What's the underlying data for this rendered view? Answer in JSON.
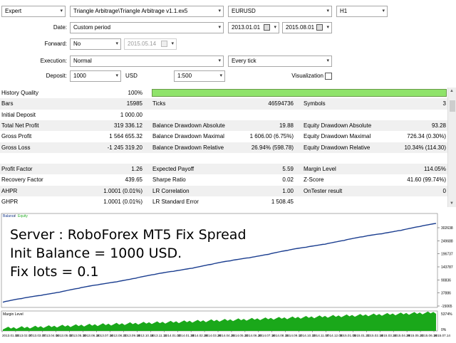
{
  "settings": {
    "mode": "Expert",
    "expert_file": "Triangle Arbitrage\\Triangle Arbitrage v1.1.ex5",
    "symbol": "EURUSD",
    "timeframe": "H1",
    "date_label": "Date:",
    "date_mode": "Custom period",
    "date_from": "2013.01.01",
    "date_to": "2015.08.01",
    "forward_label": "Forward:",
    "forward_value": "No",
    "forward_date": "2015.05.14",
    "execution_label": "Execution:",
    "execution_value": "Normal",
    "tick_model": "Every tick",
    "deposit_label": "Deposit:",
    "deposit_value": "1000",
    "currency": "USD",
    "leverage": "1:500",
    "visualization_label": "Visualization"
  },
  "stats": {
    "history_quality_label": "History Quality",
    "history_quality_value": "100%",
    "rows": [
      {
        "c1l": "Bars",
        "c1v": "15985",
        "c2l": "Ticks",
        "c2v": "46594736",
        "c3l": "Symbols",
        "c3v": "3"
      },
      {
        "c1l": "Initial Deposit",
        "c1v": "1 000.00",
        "c2l": "",
        "c2v": "",
        "c3l": "",
        "c3v": ""
      },
      {
        "c1l": "Total Net Profit",
        "c1v": "319 336.12",
        "c2l": "Balance Drawdown Absolute",
        "c2v": "19.88",
        "c3l": "Equity Drawdown Absolute",
        "c3v": "93.28"
      },
      {
        "c1l": "Gross Profit",
        "c1v": "1 564 655.32",
        "c2l": "Balance Drawdown Maximal",
        "c2v": "1 606.00 (6.75%)",
        "c3l": "Equity Drawdown Maximal",
        "c3v": "726.34 (0.30%)"
      },
      {
        "c1l": "Gross Loss",
        "c1v": "-1 245 319.20",
        "c2l": "Balance Drawdown Relative",
        "c2v": "26.94% (598.78)",
        "c3l": "Equity Drawdown Relative",
        "c3v": "10.34% (114.30)"
      },
      {
        "c1l": "",
        "c1v": "",
        "c2l": "",
        "c2v": "",
        "c3l": "",
        "c3v": ""
      },
      {
        "c1l": "Profit Factor",
        "c1v": "1.26",
        "c2l": "Expected Payoff",
        "c2v": "5.59",
        "c3l": "Margin Level",
        "c3v": "114.05%"
      },
      {
        "c1l": "Recovery Factor",
        "c1v": "439.65",
        "c2l": "Sharpe Ratio",
        "c2v": "0.02",
        "c3l": "Z-Score",
        "c3v": "41.60 (99.74%)"
      },
      {
        "c1l": "AHPR",
        "c1v": "1.0001 (0.01%)",
        "c2l": "LR Correlation",
        "c2v": "1.00",
        "c3l": "OnTester result",
        "c3v": "0"
      },
      {
        "c1l": "GHPR",
        "c1v": "1.0001 (0.01%)",
        "c2l": "LR Standard Error",
        "c2v": "1 508.45",
        "c3l": "",
        "c3v": ""
      }
    ]
  },
  "chart": {
    "legend_balance": "Balance",
    "legend_sep": " / ",
    "legend_equity": "Equity",
    "y_ticks": [
      "302638",
      "249688",
      "196737",
      "143787",
      "90836",
      "37886",
      "-15065"
    ],
    "margin_label": "Margin Level",
    "margin_ticks": [
      "5374%",
      "0%"
    ],
    "x_ticks": [
      "2013.01.03",
      "2013.02.07",
      "2013.03.07",
      "2013.04.04",
      "2013.05.02",
      "2013.05.30",
      "2013.06.24",
      "2013.07.24",
      "2013.08.21",
      "2013.09.18",
      "2013.10.16",
      "2013.11.11",
      "2014.01.02",
      "2014.01.30",
      "2014.02.28",
      "2014.03.28",
      "2014.04.25",
      "2014.05.23",
      "2014.06.20",
      "2014.07.18",
      "2014.08.15",
      "2014.09.12",
      "2014.10.10",
      "2014.11.07",
      "2014.12.05",
      "2015.01.05",
      "2015.01.21",
      "2015.02.18",
      "2015.03.24",
      "2015.04.29",
      "2015.05.21",
      "2015.06.18",
      "2015.07.14"
    ],
    "colors": {
      "balance": "#1a3d8f",
      "margin": "#1aa81a",
      "quality_bar": "#8fe36a"
    },
    "overlay_lines": [
      "Server : RoboForex MT5 Fix Spread",
      "Init Balance = 1000 USD.",
      "Fix lots = 0.1"
    ]
  }
}
